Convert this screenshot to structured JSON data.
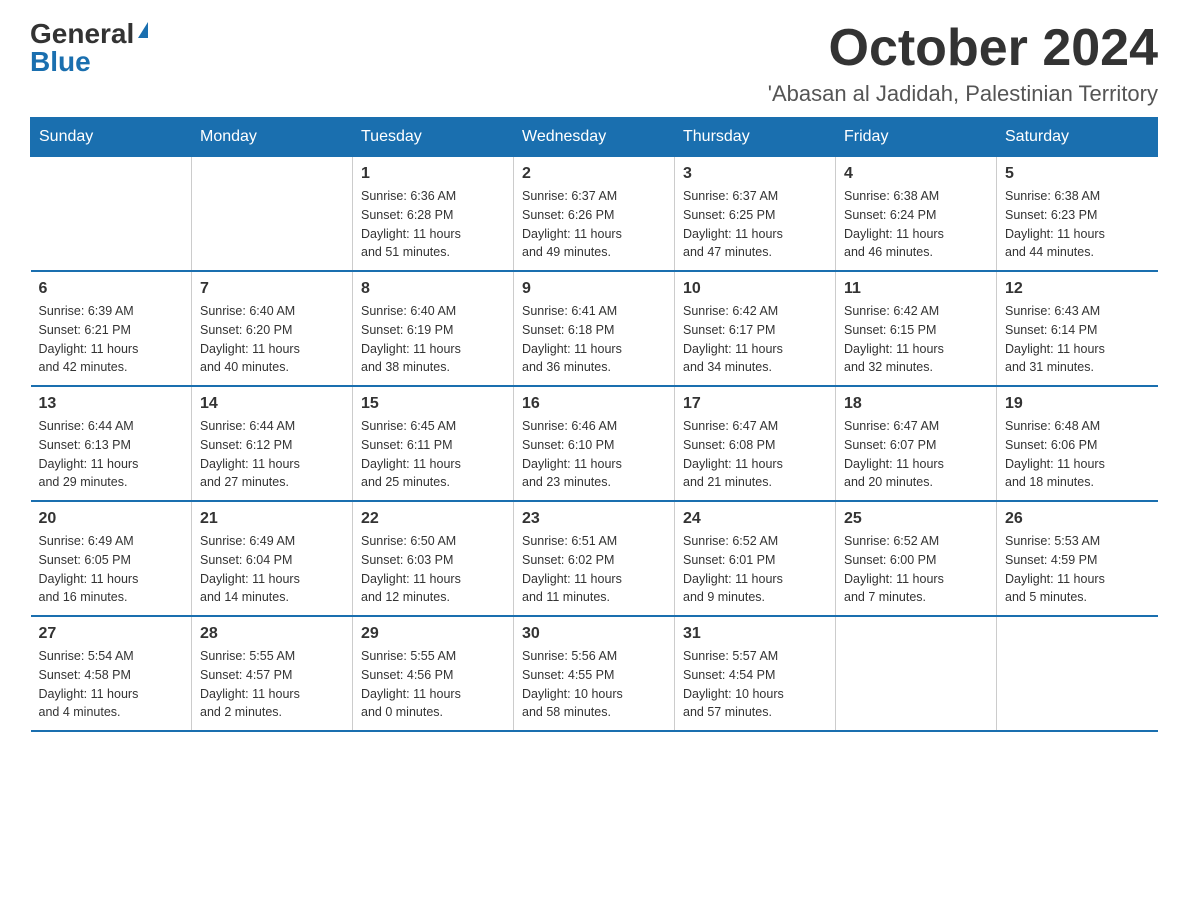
{
  "header": {
    "logo_general": "General",
    "logo_blue": "Blue",
    "month": "October 2024",
    "location": "'Abasan al Jadidah, Palestinian Territory"
  },
  "weekdays": [
    "Sunday",
    "Monday",
    "Tuesday",
    "Wednesday",
    "Thursday",
    "Friday",
    "Saturday"
  ],
  "weeks": [
    [
      {
        "day": "",
        "info": ""
      },
      {
        "day": "",
        "info": ""
      },
      {
        "day": "1",
        "info": "Sunrise: 6:36 AM\nSunset: 6:28 PM\nDaylight: 11 hours\nand 51 minutes."
      },
      {
        "day": "2",
        "info": "Sunrise: 6:37 AM\nSunset: 6:26 PM\nDaylight: 11 hours\nand 49 minutes."
      },
      {
        "day": "3",
        "info": "Sunrise: 6:37 AM\nSunset: 6:25 PM\nDaylight: 11 hours\nand 47 minutes."
      },
      {
        "day": "4",
        "info": "Sunrise: 6:38 AM\nSunset: 6:24 PM\nDaylight: 11 hours\nand 46 minutes."
      },
      {
        "day": "5",
        "info": "Sunrise: 6:38 AM\nSunset: 6:23 PM\nDaylight: 11 hours\nand 44 minutes."
      }
    ],
    [
      {
        "day": "6",
        "info": "Sunrise: 6:39 AM\nSunset: 6:21 PM\nDaylight: 11 hours\nand 42 minutes."
      },
      {
        "day": "7",
        "info": "Sunrise: 6:40 AM\nSunset: 6:20 PM\nDaylight: 11 hours\nand 40 minutes."
      },
      {
        "day": "8",
        "info": "Sunrise: 6:40 AM\nSunset: 6:19 PM\nDaylight: 11 hours\nand 38 minutes."
      },
      {
        "day": "9",
        "info": "Sunrise: 6:41 AM\nSunset: 6:18 PM\nDaylight: 11 hours\nand 36 minutes."
      },
      {
        "day": "10",
        "info": "Sunrise: 6:42 AM\nSunset: 6:17 PM\nDaylight: 11 hours\nand 34 minutes."
      },
      {
        "day": "11",
        "info": "Sunrise: 6:42 AM\nSunset: 6:15 PM\nDaylight: 11 hours\nand 32 minutes."
      },
      {
        "day": "12",
        "info": "Sunrise: 6:43 AM\nSunset: 6:14 PM\nDaylight: 11 hours\nand 31 minutes."
      }
    ],
    [
      {
        "day": "13",
        "info": "Sunrise: 6:44 AM\nSunset: 6:13 PM\nDaylight: 11 hours\nand 29 minutes."
      },
      {
        "day": "14",
        "info": "Sunrise: 6:44 AM\nSunset: 6:12 PM\nDaylight: 11 hours\nand 27 minutes."
      },
      {
        "day": "15",
        "info": "Sunrise: 6:45 AM\nSunset: 6:11 PM\nDaylight: 11 hours\nand 25 minutes."
      },
      {
        "day": "16",
        "info": "Sunrise: 6:46 AM\nSunset: 6:10 PM\nDaylight: 11 hours\nand 23 minutes."
      },
      {
        "day": "17",
        "info": "Sunrise: 6:47 AM\nSunset: 6:08 PM\nDaylight: 11 hours\nand 21 minutes."
      },
      {
        "day": "18",
        "info": "Sunrise: 6:47 AM\nSunset: 6:07 PM\nDaylight: 11 hours\nand 20 minutes."
      },
      {
        "day": "19",
        "info": "Sunrise: 6:48 AM\nSunset: 6:06 PM\nDaylight: 11 hours\nand 18 minutes."
      }
    ],
    [
      {
        "day": "20",
        "info": "Sunrise: 6:49 AM\nSunset: 6:05 PM\nDaylight: 11 hours\nand 16 minutes."
      },
      {
        "day": "21",
        "info": "Sunrise: 6:49 AM\nSunset: 6:04 PM\nDaylight: 11 hours\nand 14 minutes."
      },
      {
        "day": "22",
        "info": "Sunrise: 6:50 AM\nSunset: 6:03 PM\nDaylight: 11 hours\nand 12 minutes."
      },
      {
        "day": "23",
        "info": "Sunrise: 6:51 AM\nSunset: 6:02 PM\nDaylight: 11 hours\nand 11 minutes."
      },
      {
        "day": "24",
        "info": "Sunrise: 6:52 AM\nSunset: 6:01 PM\nDaylight: 11 hours\nand 9 minutes."
      },
      {
        "day": "25",
        "info": "Sunrise: 6:52 AM\nSunset: 6:00 PM\nDaylight: 11 hours\nand 7 minutes."
      },
      {
        "day": "26",
        "info": "Sunrise: 5:53 AM\nSunset: 4:59 PM\nDaylight: 11 hours\nand 5 minutes."
      }
    ],
    [
      {
        "day": "27",
        "info": "Sunrise: 5:54 AM\nSunset: 4:58 PM\nDaylight: 11 hours\nand 4 minutes."
      },
      {
        "day": "28",
        "info": "Sunrise: 5:55 AM\nSunset: 4:57 PM\nDaylight: 11 hours\nand 2 minutes."
      },
      {
        "day": "29",
        "info": "Sunrise: 5:55 AM\nSunset: 4:56 PM\nDaylight: 11 hours\nand 0 minutes."
      },
      {
        "day": "30",
        "info": "Sunrise: 5:56 AM\nSunset: 4:55 PM\nDaylight: 10 hours\nand 58 minutes."
      },
      {
        "day": "31",
        "info": "Sunrise: 5:57 AM\nSunset: 4:54 PM\nDaylight: 10 hours\nand 57 minutes."
      },
      {
        "day": "",
        "info": ""
      },
      {
        "day": "",
        "info": ""
      }
    ]
  ]
}
